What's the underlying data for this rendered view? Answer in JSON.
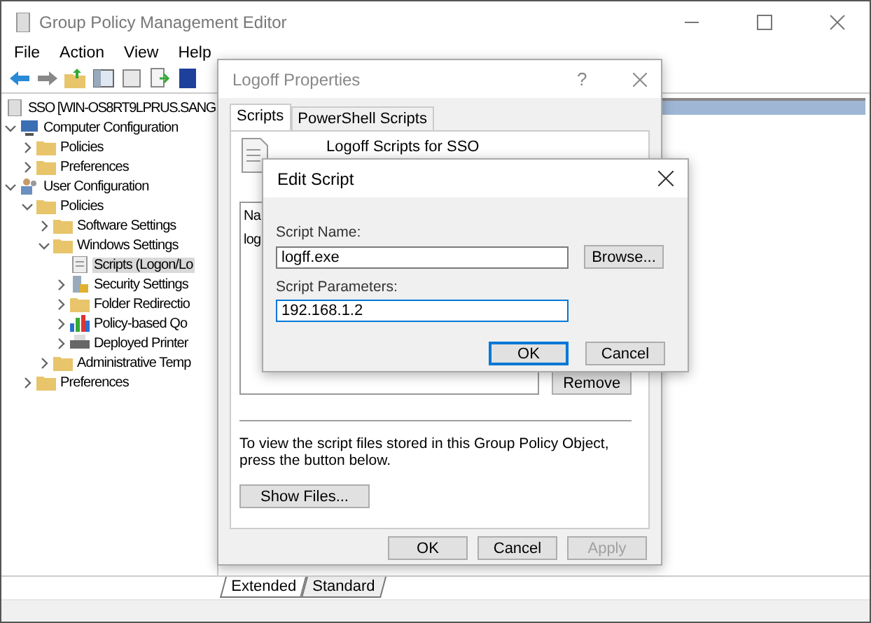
{
  "window": {
    "title": "Group Policy Management Editor"
  },
  "menu": [
    "File",
    "Action",
    "View",
    "Help"
  ],
  "tree": [
    {
      "label": "SSO [WIN-OS8RT9LPRUS.SANG",
      "kind": "gpo",
      "selected": false,
      "children": [
        {
          "label": "Computer Configuration",
          "kind": "computer",
          "expanded": true,
          "selected": false,
          "children": [
            {
              "label": "Policies",
              "kind": "folder",
              "expanded": false,
              "selected": false
            },
            {
              "label": "Preferences",
              "kind": "folder",
              "expanded": false,
              "selected": false
            }
          ]
        },
        {
          "label": "User Configuration",
          "kind": "user",
          "expanded": true,
          "selected": false,
          "children": [
            {
              "label": "Policies",
              "kind": "folder",
              "expanded": true,
              "selected": false,
              "children": [
                {
                  "label": "Software Settings",
                  "kind": "folder",
                  "expanded": false,
                  "selected": false
                },
                {
                  "label": "Windows Settings",
                  "kind": "folder",
                  "expanded": true,
                  "selected": false,
                  "children": [
                    {
                      "label": "Scripts (Logon/Lo",
                      "kind": "script",
                      "selected": true
                    },
                    {
                      "label": "Security Settings",
                      "kind": "security",
                      "expanded": false,
                      "selected": false
                    },
                    {
                      "label": "Folder Redirectio",
                      "kind": "folder",
                      "expanded": false,
                      "selected": false
                    },
                    {
                      "label": "Policy-based Qo",
                      "kind": "chart",
                      "expanded": false,
                      "selected": false
                    },
                    {
                      "label": "Deployed Printer",
                      "kind": "printer",
                      "expanded": false,
                      "selected": false
                    }
                  ]
                },
                {
                  "label": "Administrative Temp",
                  "kind": "folder",
                  "expanded": false,
                  "selected": false
                }
              ]
            },
            {
              "label": "Preferences",
              "kind": "folder",
              "expanded": false,
              "selected": false
            }
          ]
        }
      ]
    }
  ],
  "bottom_tabs": [
    {
      "label": "Extended",
      "selected": true
    },
    {
      "label": "Standard",
      "selected": false
    }
  ],
  "properties_dialog": {
    "title": "Logoff Properties",
    "help_button": "?",
    "tabs": [
      {
        "label": "Scripts",
        "selected": true
      },
      {
        "label": "PowerShell Scripts",
        "selected": false
      }
    ],
    "heading": "Logoff Scripts for SSO",
    "list": {
      "column_header": "Na",
      "rows": [
        "log"
      ]
    },
    "remove_button": "Remove",
    "note": "To view the script files stored in this Group Policy Object, press the button below.",
    "show_files_button": "Show Files...",
    "buttons": [
      {
        "label": "OK",
        "disabled": false
      },
      {
        "label": "Cancel",
        "disabled": false
      },
      {
        "label": "Apply",
        "disabled": true
      }
    ]
  },
  "edit_dialog": {
    "title": "Edit Script",
    "fields": [
      {
        "label": "Script Name:",
        "value": "logff.exe",
        "focused": false,
        "button": "Browse..."
      },
      {
        "label": "Script Parameters:",
        "value": "192.168.1.2",
        "focused": true
      }
    ],
    "buttons": [
      {
        "label": "OK",
        "default": true
      },
      {
        "label": "Cancel",
        "default": false
      }
    ]
  }
}
